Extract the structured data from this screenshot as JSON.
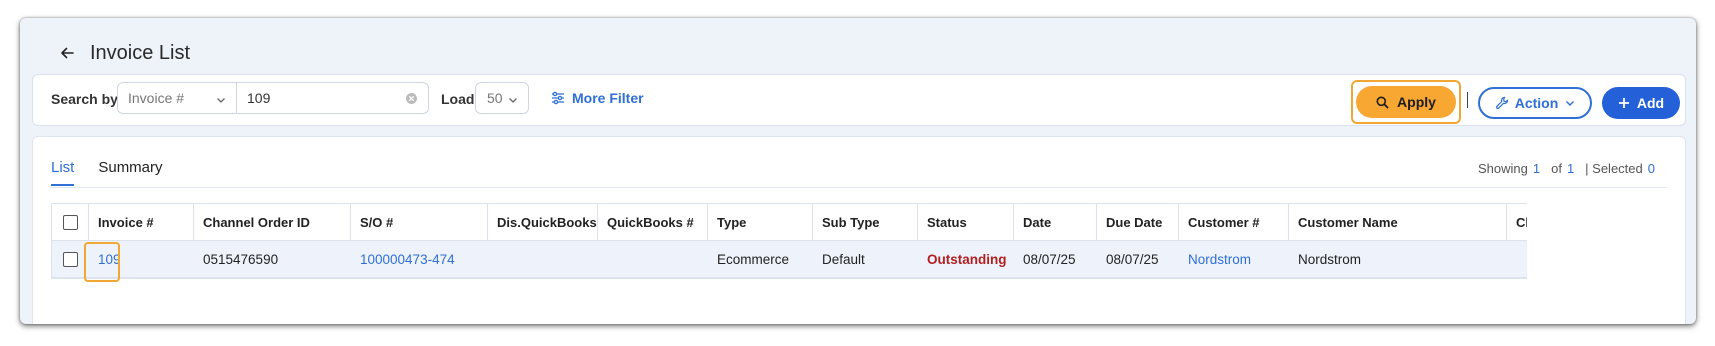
{
  "header": {
    "title": "Invoice List"
  },
  "filters": {
    "search_by_label": "Search by",
    "search_by_value": "Invoice #",
    "search_value": "109",
    "load_label": "Load",
    "load_value": "50",
    "more_filter_label": "More Filter"
  },
  "toolbar": {
    "apply_label": "Apply",
    "action_label": "Action",
    "add_label": "Add"
  },
  "tabs": [
    {
      "label": "List",
      "active": true
    },
    {
      "label": "Summary",
      "active": false
    }
  ],
  "summary": {
    "showing_label": "Showing",
    "showing_from": "1",
    "of_label": "of",
    "total": "1",
    "selected_label": "| Selected",
    "selected_count": "0"
  },
  "table": {
    "columns": [
      "Invoice #",
      "Channel Order ID",
      "S/O #",
      "Dis.QuickBooks",
      "QuickBooks #",
      "Type",
      "Sub Type",
      "Status",
      "Date",
      "Due Date",
      "Customer #",
      "Customer Name",
      "Cl"
    ],
    "rows": [
      {
        "invoice": "109",
        "channel_order_id": "0515476590",
        "so": "100000473-474",
        "dis_quickbooks": "",
        "quickbooks": "",
        "type": "Ecommerce",
        "sub_type": "Default",
        "status": "Outstanding",
        "date": "08/07/25",
        "due_date": "08/07/25",
        "customer_no": "Nordstrom",
        "customer_name": "Nordstrom"
      }
    ]
  },
  "colors": {
    "accent": "#2f6fd6",
    "apply": "#f7a732",
    "status_outstanding": "#b21f1f"
  }
}
